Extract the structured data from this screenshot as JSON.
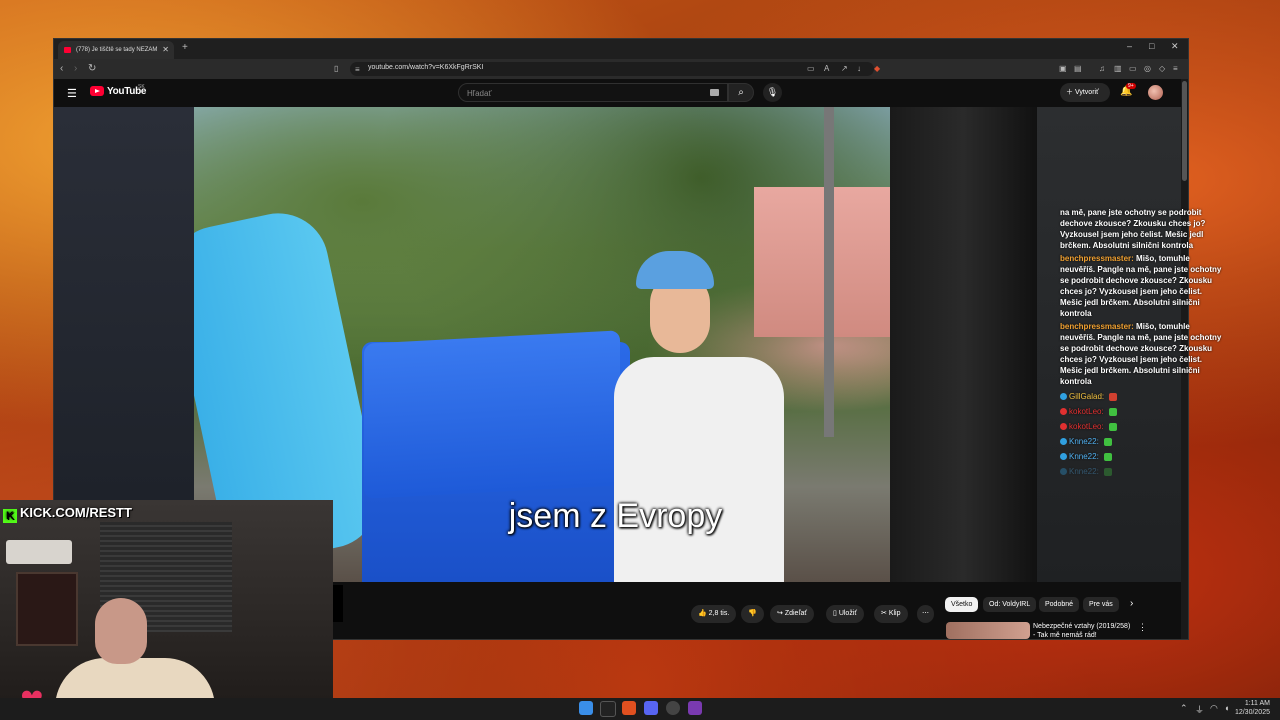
{
  "browser": {
    "tab_title": "(778) Je tiščtě se tady NEZAM",
    "url": "youtube.com/watch?v=K6XkFgRrSKI",
    "new_tab_symbol": "+"
  },
  "youtube": {
    "logo_text": "YouTube",
    "country_code": "SK",
    "search_placeholder": "Hľadať",
    "create_label": "Vytvoriť",
    "notification_count": "9+"
  },
  "video": {
    "subtitle": "jsem z Evropy"
  },
  "chat": {
    "messages": [
      {
        "user": "",
        "text": "na mě, pane jste ochotny se podrobit dechove zkousce? Zkousku chces jo? Vyzkousel jsem jeho čelist. Mešic jedl brčkem. Absolutni silnični kontrola"
      },
      {
        "user": "benchpressmaster:",
        "text": "Mišo, tomuhle neuvěříš. Pangle na mě, pane jste ochotny se podrobit dechove zkousce? Zkousku chces jo? Vyzkousel jsem jeho čelist. Mešic jedl brčkem. Absolutni silnični kontrola"
      },
      {
        "user": "benchpressmaster:",
        "text": "Mišo, tomuhle neuvěříš. Pangle na mě, pane jste ochotny se podrobit dechove zkousce? Zkousku chces jo? Vyzkousel jsem jeho čelist. Mešic jedl brčkem. Absolutni silnični kontrola"
      }
    ],
    "short_messages": [
      {
        "user": "GillGalad:",
        "color": "#f0c040",
        "badge": "#30a0e0",
        "emote": "#d04030"
      },
      {
        "user": "kokotLeo:",
        "color": "#e03030",
        "badge": "#e03030",
        "emote": "#40c040"
      },
      {
        "user": "kokotLeo:",
        "color": "#e03030",
        "badge": "#e03030",
        "emote": "#40c040"
      },
      {
        "user": "Knne22:",
        "color": "#50b0f0",
        "badge": "#30a0e0",
        "emote": "#40c040"
      },
      {
        "user": "Knne22:",
        "color": "#50b0f0",
        "badge": "#30a0e0",
        "emote": "#40c040"
      },
      {
        "user": "Knne22:",
        "color": "#50b0f0",
        "badge": "#30a0e0",
        "emote": "#40c040"
      }
    ]
  },
  "actions": {
    "like_count": "2,8 tis.",
    "share": "Zdieľať",
    "save": "Uložiť",
    "clip": "Klip",
    "more": "⋯"
  },
  "chips": [
    "Všetko",
    "Od: VoldyIRL",
    "Podobné",
    "Pre vás"
  ],
  "recommendation": {
    "title": "Nebezpečné vztahy (2019/258) - Tak mě nemáš rád!"
  },
  "overlay": {
    "kick_text": "KICK.COM/RESTT"
  },
  "clock": {
    "time": "1:11 AM",
    "date": "12/30/2025"
  },
  "icons": {
    "back": "‹",
    "forward": "›",
    "reload": "↻",
    "close": "✕",
    "minimize": "–",
    "maximize": "□"
  }
}
